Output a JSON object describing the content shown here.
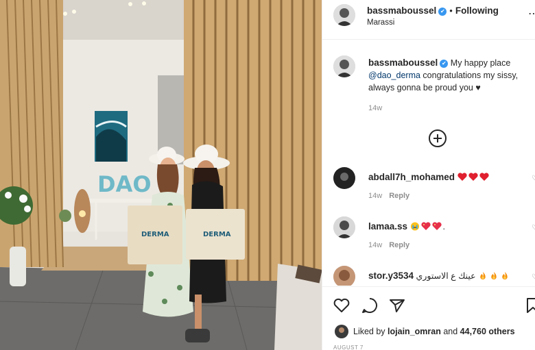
{
  "post": {
    "username": "bassmaboussel",
    "follow_status": "Following",
    "location": "Marassi",
    "verified_symbol": "✔",
    "more_icon": "more-options-icon"
  },
  "caption": {
    "username": "bassmaboussel",
    "text_1": "My happy place",
    "mention": "@dao_derma",
    "text_2": "congratulations my sissy, always gonna be proud you ♥",
    "time": "14w"
  },
  "load_more_icon": "plus-circle-icon",
  "comments": [
    {
      "username": "abdall7h_mohamed",
      "emojis": [
        "heart",
        "heart",
        "heart"
      ],
      "text": "",
      "time": "14w",
      "reply": "Reply"
    },
    {
      "username": "lamaa.ss",
      "emojis": [
        "crying-face",
        "heart-sparkle",
        "heart-sparkle"
      ],
      "text": ".",
      "time": "14w",
      "reply": "Reply"
    },
    {
      "username": "stor.y3534",
      "emojis": [
        "fire",
        "fire",
        "fire"
      ],
      "text": "عينك ع الاستوري",
      "time": "",
      "reply": ""
    }
  ],
  "actions": {
    "like_icon": "heart-icon",
    "comment_icon": "comment-icon",
    "share_icon": "paper-plane-icon",
    "save_icon": "bookmark-icon"
  },
  "likes": {
    "prefix": "Liked by",
    "user": "lojain_omran",
    "conjunction": "and",
    "count": "44,760 others"
  },
  "date": "AUGUST 7",
  "colors": {
    "link": "#00376b",
    "verified": "#3897f0",
    "heart": "#ed4956",
    "muted": "#8e8e8e"
  }
}
